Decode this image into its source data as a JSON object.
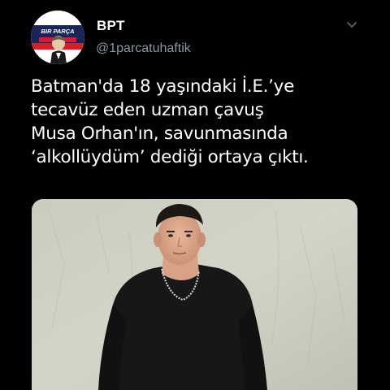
{
  "tweet": {
    "author": {
      "display_name": "BPT",
      "handle": "@1parcatuhaftik",
      "avatar_icon": "profile-avatar-icon",
      "avatar_text": "BIR PARÇA"
    },
    "menu_icon": "chevron-down-icon",
    "text_lines": [
      "Batman'da 18 yaşındaki İ.E.’ye",
      "tecavüz eden uzman çavuş",
      "Musa Orhan'ın, savunmasında",
      "‘alkollüydüm’ dediği ortaya çıktı."
    ],
    "media": {
      "type": "photo",
      "icon": "photo-person-icon"
    }
  },
  "colors": {
    "background": "#000000",
    "text": "#ffffff",
    "secondary_text": "#8b98a5",
    "avatar_red": "#d62027",
    "avatar_navy": "#1a2557"
  }
}
